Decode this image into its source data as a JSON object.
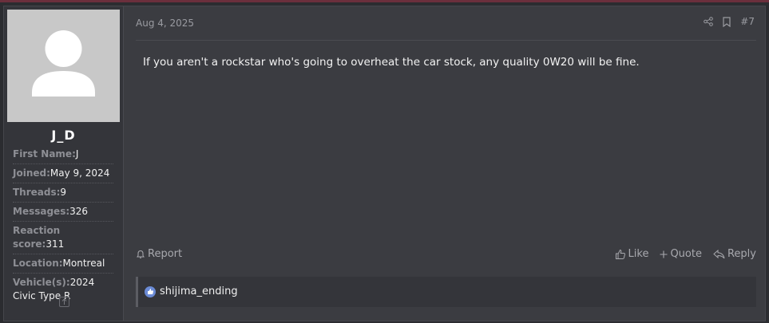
{
  "post": {
    "date": "Aug 4, 2025",
    "number": "#7",
    "message": "If you aren't a rockstar who's going to overheat the car stock, any quality 0W20 will be fine.",
    "report_label": "Report",
    "like_label": "Like",
    "quote_label": "Quote",
    "reply_label": "Reply"
  },
  "user": {
    "username": "J_D",
    "extras": [
      {
        "label": "First Name:",
        "value": "J"
      },
      {
        "label": "Joined:",
        "value": "May 9, 2024"
      },
      {
        "label": "Threads:",
        "value": "9"
      },
      {
        "label": "Messages:",
        "value": "326"
      },
      {
        "label": "Reaction score:",
        "value": "311"
      },
      {
        "label": "Location:",
        "value": "Montreal"
      },
      {
        "label": "Vehicle(s):",
        "value": "2024 Civic Type R"
      }
    ]
  },
  "reactions": {
    "users": "shijima_ending"
  },
  "colors": {
    "background": "#3b3c41",
    "sidebar": "#34353a",
    "like_badge": "#6b8bd6"
  }
}
